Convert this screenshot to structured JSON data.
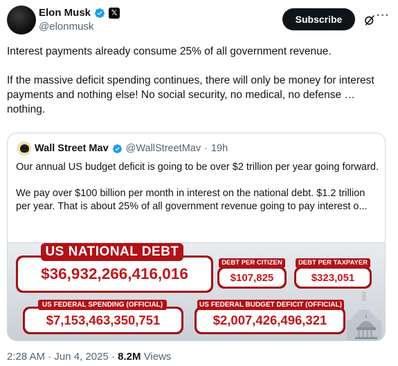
{
  "author": {
    "name": "Elon Musk",
    "handle": "@elonmusk"
  },
  "actions": {
    "subscribe_label": "Subscribe",
    "more_label": "···"
  },
  "tweet": {
    "paragraph1": "Interest payments already consume 25% of all government revenue.",
    "paragraph2": "If the massive deficit spending continues, there will only be money for interest payments and nothing else! No social security, no medical, no defense … nothing."
  },
  "quote": {
    "name": "Wall Street Mav",
    "handle": "@WallStreetMav",
    "separator": "·",
    "time": "19h",
    "paragraph1": "Our annual US budget deficit is going to be over $2 trillion per year going forward.",
    "paragraph2": "We pay over $100 billion per month in interest on the national debt. $1.2 trillion per year. That is about 25% of all government revenue going to pay interest o..."
  },
  "debt_clock": {
    "title": "US NATIONAL DEBT",
    "national_debt": "$36,932,266,416,016",
    "per_citizen_label": "DEBT PER CITIZEN",
    "per_citizen": "$107,825",
    "per_taxpayer_label": "DEBT PER TAXPAYER",
    "per_taxpayer": "$323,051",
    "spending_label": "US FEDERAL SPENDING (OFFICIAL)",
    "spending": "$7,153,463,350,751",
    "deficit_label": "US FEDERAL BUDGET DEFICIT (OFFICIAL)",
    "deficit": "$2,007,426,496,321"
  },
  "footer": {
    "time": "2:28 AM",
    "separator": "·",
    "date": "Jun 4, 2025",
    "separator2": "·",
    "views_count": "8.2M",
    "views_label": "Views"
  },
  "colors": {
    "verified": "#1d9bf0",
    "debt_red": "#c4161c",
    "text_secondary": "#536471"
  },
  "icons": [
    "verified-badge-icon",
    "x-logo-icon",
    "grok-icon",
    "more-icon",
    "capitol-icon"
  ]
}
